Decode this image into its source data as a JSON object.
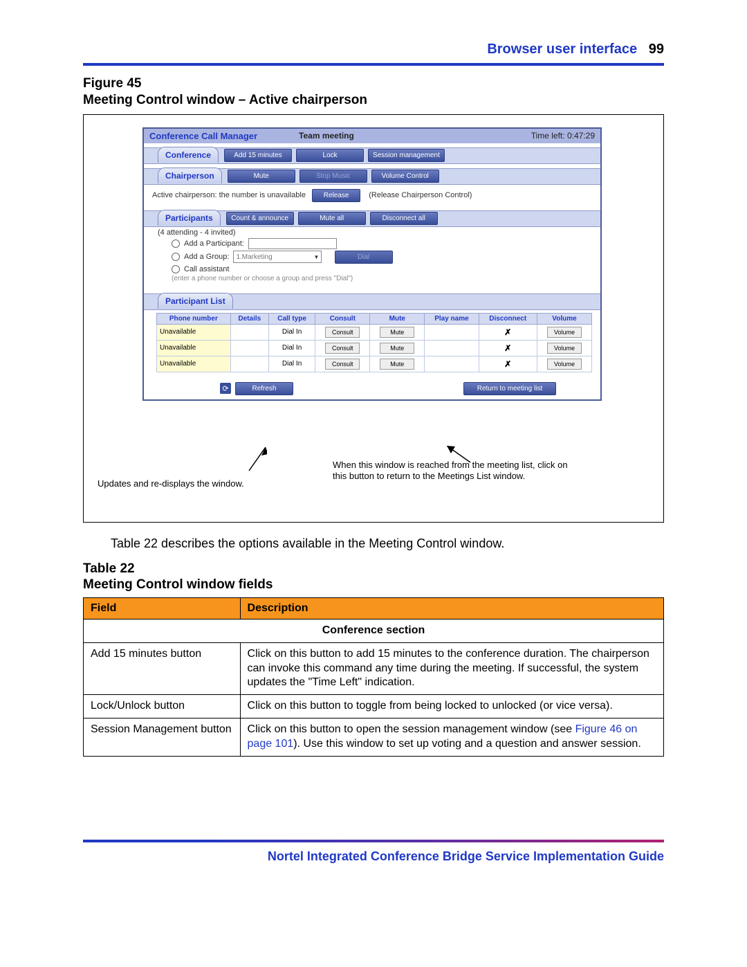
{
  "header": {
    "breadcrumb": "Browser user interface",
    "page": "99"
  },
  "figure": {
    "label": "Figure 45",
    "caption": "Meeting Control window – Active chairperson"
  },
  "ccm": {
    "brand": "Conference Call Manager",
    "meeting": "Team meeting",
    "timeleft_label": "Time left:",
    "timeleft_value": "0:47:29",
    "conference": {
      "tab": "Conference",
      "add15": "Add 15 minutes",
      "lock": "Lock",
      "session": "Session management"
    },
    "chairperson": {
      "tab": "Chairperson",
      "mute": "Mute",
      "stop_music": "Stop Music",
      "volume": "Volume Control",
      "status": "Active chairperson: the number is unavailable",
      "release": "Release",
      "release_desc": "(Release Chairperson Control)"
    },
    "participants": {
      "tab": "Participants",
      "count_announce": "Count & announce",
      "mute_all": "Mute all",
      "disconnect_all": "Disconnect all",
      "counts": "(4 attending - 4 invited)",
      "add_participant": "Add a Participant:",
      "add_group": "Add a Group:",
      "group_selected": "1.Marketing",
      "dial": "Dial",
      "call_assistant": "Call assistant",
      "hint": "(enter a phone number or choose a group and press \"Dial\")"
    },
    "plist": {
      "tab": "Participant List",
      "headers": {
        "phone": "Phone number",
        "details": "Details",
        "calltype": "Call type",
        "consult": "Consult",
        "mute": "Mute",
        "playname": "Play name",
        "disconnect": "Disconnect",
        "volume": "Volume"
      },
      "rows": [
        {
          "phone": "Unavailable",
          "calltype": "Dial In",
          "consult": "Consult",
          "mute": "Mute",
          "volume": "Volume"
        },
        {
          "phone": "Unavailable",
          "calltype": "Dial In",
          "consult": "Consult",
          "mute": "Mute",
          "volume": "Volume"
        },
        {
          "phone": "Unavailable",
          "calltype": "Dial In",
          "consult": "Consult",
          "mute": "Mute",
          "volume": "Volume"
        }
      ]
    },
    "footer": {
      "refresh": "Refresh",
      "return": "Return to meeting list"
    }
  },
  "annotations": {
    "refresh_note": "Updates and re-displays the window.",
    "return_note": "When this window is reached from the meeting list, click on this button to return to the Meetings List window."
  },
  "paragraph": "Table 22 describes the options available in the Meeting Control window.",
  "table": {
    "label": "Table 22",
    "caption": "Meeting Control window fields",
    "col1": "Field",
    "col2": "Description",
    "section": "Conference section",
    "rows": [
      {
        "field": "Add 15 minutes button",
        "desc": "Click on this button to add 15 minutes to the conference duration. The chairperson can invoke this command any time during the meeting. If successful, the system updates the \"Time Left\" indication."
      },
      {
        "field": "Lock/Unlock button",
        "desc": "Click on this button to toggle from being locked to unlocked (or vice versa)."
      },
      {
        "field": "Session Management button",
        "desc_pre": "Click on this button to open the session management window (see ",
        "link": "Figure 46 on page 101",
        "desc_post": "). Use this window to set up voting and a question and answer session."
      }
    ]
  },
  "footer_text": "Nortel Integrated Conference Bridge Service Implementation Guide"
}
